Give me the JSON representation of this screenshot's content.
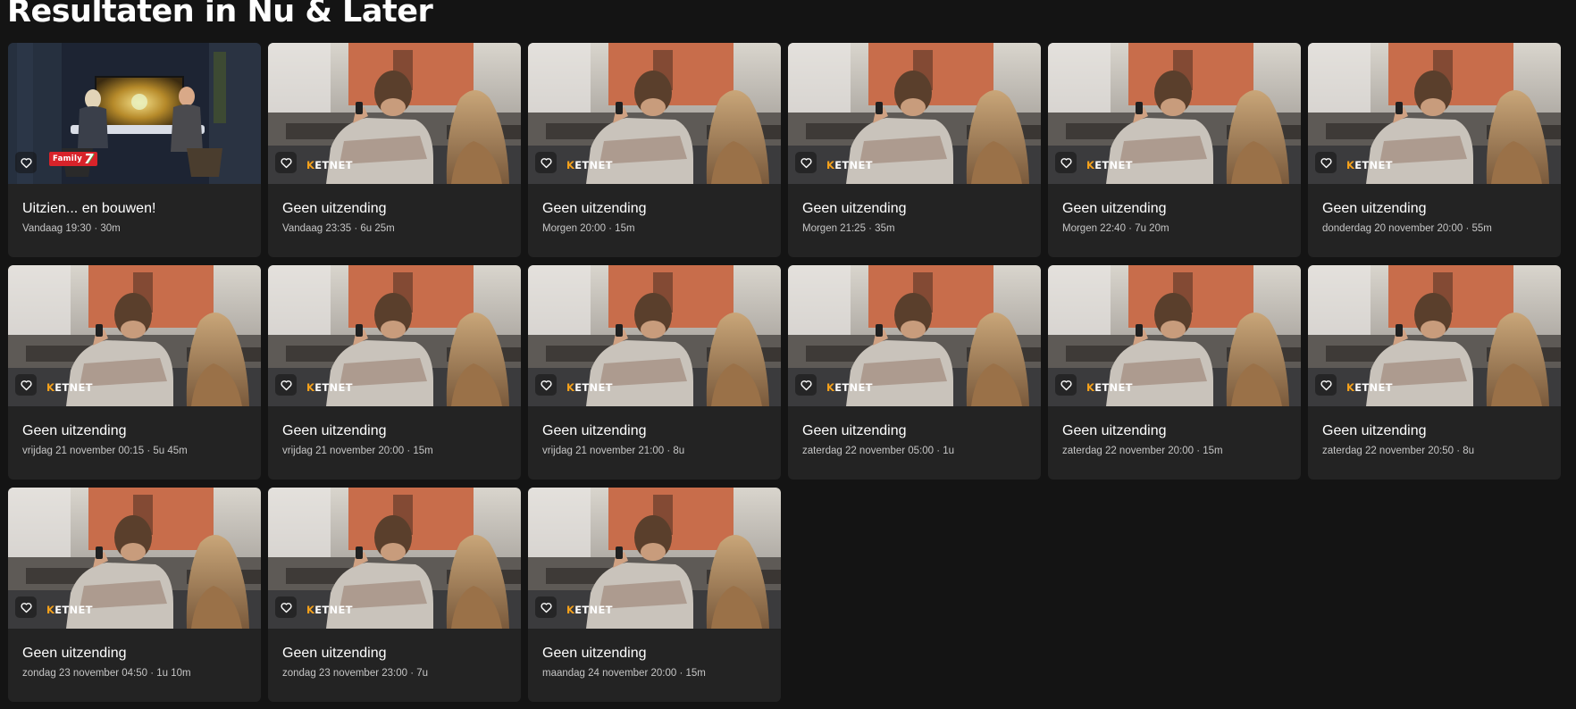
{
  "page": {
    "title": "Resultaten in Nu & Later"
  },
  "cards": [
    {
      "title": "Uitzien... en bouwen!",
      "meta": "Vandaag 19:30 · 30m",
      "channel_name": "family7-logo",
      "channel_text": "Family",
      "channel_digit": "7",
      "image": "studio-talk-show"
    },
    {
      "title": "Geen uitzending",
      "meta": "Vandaag 23:35 · 6u 25m",
      "channel_name": "ketnet-logo",
      "channel_k": "K",
      "channel_rest": "ETNET",
      "image": "couple-watching-tv"
    },
    {
      "title": "Geen uitzending",
      "meta": "Morgen 20:00 · 15m",
      "channel_name": "ketnet-logo",
      "channel_k": "K",
      "channel_rest": "ETNET",
      "image": "couple-watching-tv"
    },
    {
      "title": "Geen uitzending",
      "meta": "Morgen 21:25 · 35m",
      "channel_name": "ketnet-logo",
      "channel_k": "K",
      "channel_rest": "ETNET",
      "image": "couple-watching-tv"
    },
    {
      "title": "Geen uitzending",
      "meta": "Morgen 22:40 · 7u 20m",
      "channel_name": "ketnet-logo",
      "channel_k": "K",
      "channel_rest": "ETNET",
      "image": "couple-watching-tv"
    },
    {
      "title": "Geen uitzending",
      "meta": "donderdag 20 november 20:00 · 55m",
      "channel_name": "ketnet-logo",
      "channel_k": "K",
      "channel_rest": "ETNET",
      "image": "couple-watching-tv"
    },
    {
      "title": "Geen uitzending",
      "meta": "vrijdag 21 november 00:15 · 5u 45m",
      "channel_name": "ketnet-logo",
      "channel_k": "K",
      "channel_rest": "ETNET",
      "image": "couple-watching-tv"
    },
    {
      "title": "Geen uitzending",
      "meta": "vrijdag 21 november 20:00 · 15m",
      "channel_name": "ketnet-logo",
      "channel_k": "K",
      "channel_rest": "ETNET",
      "image": "couple-watching-tv"
    },
    {
      "title": "Geen uitzending",
      "meta": "vrijdag 21 november 21:00 · 8u",
      "channel_name": "ketnet-logo",
      "channel_k": "K",
      "channel_rest": "ETNET",
      "image": "couple-watching-tv"
    },
    {
      "title": "Geen uitzending",
      "meta": "zaterdag 22 november 05:00 · 1u",
      "channel_name": "ketnet-logo",
      "channel_k": "K",
      "channel_rest": "ETNET",
      "image": "couple-watching-tv"
    },
    {
      "title": "Geen uitzending",
      "meta": "zaterdag 22 november 20:00 · 15m",
      "channel_name": "ketnet-logo",
      "channel_k": "K",
      "channel_rest": "ETNET",
      "image": "couple-watching-tv"
    },
    {
      "title": "Geen uitzending",
      "meta": "zaterdag 22 november 20:50 · 8u",
      "channel_name": "ketnet-logo",
      "channel_k": "K",
      "channel_rest": "ETNET",
      "image": "couple-watching-tv"
    },
    {
      "title": "Geen uitzending",
      "meta": "zondag 23 november 04:50 · 1u 10m",
      "channel_name": "ketnet-logo",
      "channel_k": "K",
      "channel_rest": "ETNET",
      "image": "couple-watching-tv"
    },
    {
      "title": "Geen uitzending",
      "meta": "zondag 23 november 23:00 · 7u",
      "channel_name": "ketnet-logo",
      "channel_k": "K",
      "channel_rest": "ETNET",
      "image": "couple-watching-tv"
    },
    {
      "title": "Geen uitzending",
      "meta": "maandag 24 november 20:00 · 15m",
      "channel_name": "ketnet-logo",
      "channel_k": "K",
      "channel_rest": "ETNET",
      "image": "couple-watching-tv"
    }
  ],
  "icons": {
    "favorite": "heart-outline-icon"
  },
  "colors": {
    "background": "#141414",
    "card": "#232323",
    "ketnet_accent": "#f6a21b",
    "family7_red": "#d8232a"
  }
}
